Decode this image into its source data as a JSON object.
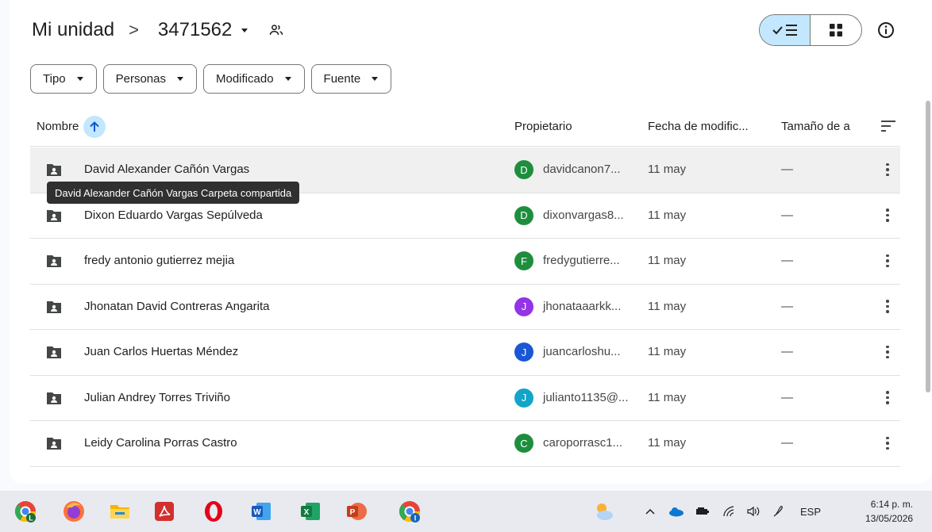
{
  "breadcrumb": {
    "root": "Mi unidad",
    "separator": ">",
    "current": "3471562"
  },
  "filters": [
    {
      "label": "Tipo"
    },
    {
      "label": "Personas"
    },
    {
      "label": "Modificado"
    },
    {
      "label": "Fuente"
    }
  ],
  "columns": {
    "name": "Nombre",
    "owner": "Propietario",
    "modified": "Fecha de modific...",
    "size": "Tamaño de a"
  },
  "rows": [
    {
      "name": "David Alexander Cañón Vargas",
      "initial": "D",
      "avatar_color": "#1e8e3e",
      "owner": "davidcanon7...",
      "modified": "11 may",
      "size": "—"
    },
    {
      "name": "Dixon Eduardo Vargas Sepúlveda",
      "initial": "D",
      "avatar_color": "#1e8e3e",
      "owner": "dixonvargas8...",
      "modified": "11 may",
      "size": "—"
    },
    {
      "name": "fredy antonio gutierrez mejia",
      "initial": "F",
      "avatar_color": "#1e8e3e",
      "owner": "fredygutierre...",
      "modified": "11 may",
      "size": "—"
    },
    {
      "name": "Jhonatan David Contreras Angarita",
      "initial": "J",
      "avatar_color": "#9334e6",
      "owner": "jhonataaarkk...",
      "modified": "11 may",
      "size": "—"
    },
    {
      "name": "Juan Carlos Huertas Méndez",
      "initial": "J",
      "avatar_color": "#1a56d6",
      "owner": "juancarloshu...",
      "modified": "11 may",
      "size": "—"
    },
    {
      "name": "Julian Andrey Torres Triviño",
      "initial": "J",
      "avatar_color": "#12a4c9",
      "owner": "julianto1135@...",
      "modified": "11 may",
      "size": "—"
    },
    {
      "name": "Leidy Carolina Porras Castro",
      "initial": "C",
      "avatar_color": "#1e8e3e",
      "owner": "caroporrasc1...",
      "modified": "11 may",
      "size": "—"
    }
  ],
  "tooltip": "David Alexander Cañón Vargas  Carpeta compartida",
  "taskbar": {
    "apps": [
      "chrome-l",
      "firefox",
      "file-explorer",
      "acrobat",
      "opera",
      "word",
      "excel",
      "powerpoint",
      "chrome-i"
    ],
    "language": "ESP",
    "time": "6:14 p. m.",
    "date": "13/05/2026"
  },
  "colors": {
    "accent": "#c2e7ff",
    "border": "#747775"
  }
}
